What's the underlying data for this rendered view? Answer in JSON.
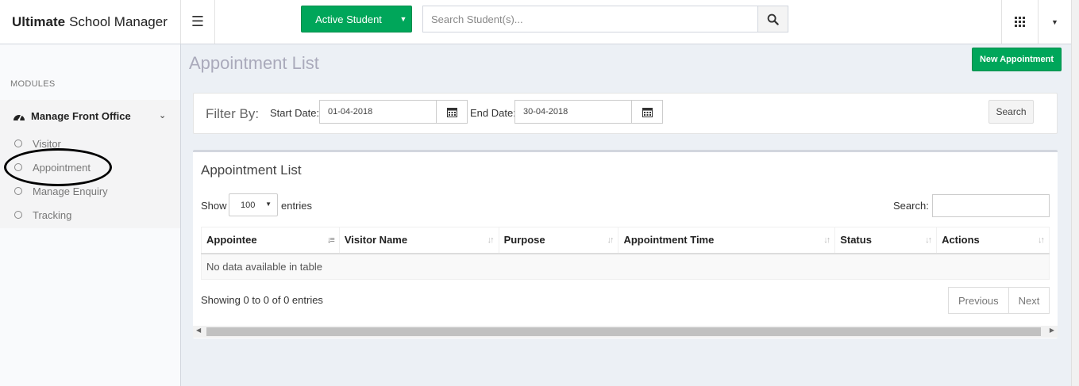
{
  "brand": {
    "bold": "Ultimate",
    "rest": "School Manager"
  },
  "topbar": {
    "active_student_label": "Active Student",
    "search_placeholder": "Search Student(s)..."
  },
  "sidebar": {
    "modules_header": "MODULES",
    "group_label": "Manage Front Office",
    "items": [
      {
        "label": "Visitor"
      },
      {
        "label": "Appointment"
      },
      {
        "label": "Manage Enquiry"
      },
      {
        "label": "Tracking"
      }
    ]
  },
  "page": {
    "title": "Appointment List",
    "new_button": "New Appointment"
  },
  "filter": {
    "label": "Filter By:",
    "start_label": "Start Date:",
    "start_value": "01-04-2018",
    "end_label": "End Date:",
    "end_value": "30-04-2018",
    "search_button": "Search"
  },
  "list": {
    "title": "Appointment List",
    "show_label": "Show",
    "page_length": "100",
    "entries_label": "entries",
    "search_label": "Search:",
    "columns": [
      "Appointee",
      "Visitor Name",
      "Purpose",
      "Appointment Time",
      "Status",
      "Actions"
    ],
    "empty_text": "No data available in table",
    "info": "Showing 0 to 0 of 0 entries",
    "prev_label": "Previous",
    "next_label": "Next"
  },
  "colors": {
    "accent_green": "#00a65a",
    "background": "#ecf0f5"
  }
}
